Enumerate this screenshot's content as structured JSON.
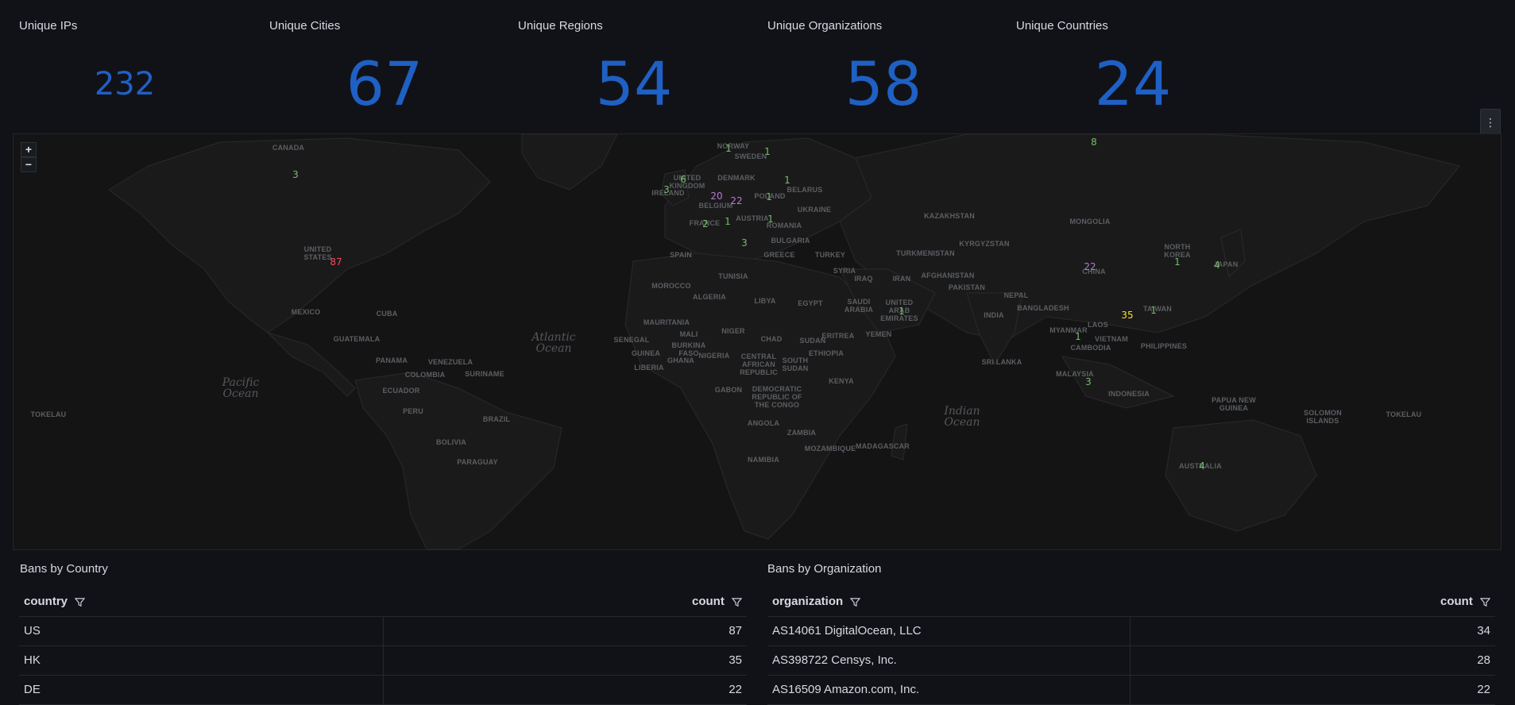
{
  "stats": [
    {
      "title": "Unique IPs",
      "value": "232"
    },
    {
      "title": "Unique Cities",
      "value": "67"
    },
    {
      "title": "Unique Regions",
      "value": "54"
    },
    {
      "title": "Unique Organizations",
      "value": "58"
    },
    {
      "title": "Unique Countries",
      "value": "24"
    }
  ],
  "panel_menu_icon": "vertical-dots-icon",
  "map": {
    "zoom_in": "+",
    "zoom_out": "−",
    "markers": [
      {
        "value": "3"
      },
      {
        "value": "87"
      },
      {
        "value": "1"
      },
      {
        "value": "1"
      },
      {
        "value": "6"
      },
      {
        "value": "3"
      },
      {
        "value": "20"
      },
      {
        "value": "22"
      },
      {
        "value": "1"
      },
      {
        "value": "1"
      },
      {
        "value": "2"
      },
      {
        "value": "1"
      },
      {
        "value": "1"
      },
      {
        "value": "3"
      },
      {
        "value": "8"
      },
      {
        "value": "22"
      },
      {
        "value": "1"
      },
      {
        "value": "4"
      },
      {
        "value": "35"
      },
      {
        "value": "1"
      },
      {
        "value": "1"
      },
      {
        "value": "1"
      },
      {
        "value": "3"
      },
      {
        "value": "4"
      }
    ],
    "labels": {
      "canada": "CANADA",
      "us": "UNITED\nSTATES",
      "mexico": "MEXICO",
      "cuba": "CUBA",
      "guatemala": "GUATEMALA",
      "panama": "PANAMA",
      "venezuela": "VENEZUELA",
      "colombia": "COLOMBIA",
      "suriname": "SURINAME",
      "ecuador": "ECUADOR",
      "peru": "PERU",
      "brazil": "BRAZIL",
      "bolivia": "BOLIVIA",
      "paraguay": "PARAGUAY",
      "norway": "NORWAY",
      "sweden": "SWEDEN",
      "uk": "UNITED\nKINGDOM",
      "ireland": "IRELAND",
      "denmark": "DENMARK",
      "belarus": "BELARUS",
      "poland": "POLAND",
      "belgium": "BELGIUM",
      "ukraine": "UKRAINE",
      "austria": "AUSTRIA",
      "france": "FRANCE",
      "romania": "ROMANIA",
      "bulgaria": "BULGARIA",
      "spain": "SPAIN",
      "greece": "GREECE",
      "turkey": "TURKEY",
      "kazakhstan": "KAZAKHSTAN",
      "mongolia": "MONGOLIA",
      "kyrgyzstan": "KYRGYZSTAN",
      "turkmenistan": "TURKMENISTAN",
      "north_korea": "NORTH\nKOREA",
      "japan": "JAPAN",
      "syria": "SYRIA",
      "iraq": "IRAQ",
      "iran": "IRAN",
      "afghanistan": "AFGHANISTAN",
      "pakistan": "PAKISTAN",
      "china": "CHINA",
      "tunisia": "TUNISIA",
      "morocco": "MOROCCO",
      "algeria": "ALGERIA",
      "libya": "LIBYA",
      "egypt": "EGYPT",
      "saudi": "SAUDI\nARABIA",
      "uae": "UNITED\nARAB\nEMIRATES",
      "nepal": "NEPAL",
      "bangladesh": "BANGLADESH",
      "india": "INDIA",
      "taiwan": "TAIWAN",
      "mauritania": "MAURITANIA",
      "mali": "MALI",
      "niger": "NIGER",
      "chad": "CHAD",
      "sudan": "SUDAN",
      "eritrea": "ERITREA",
      "yemen": "YEMEN",
      "myanmar": "MYANMAR",
      "laos": "LAOS",
      "vietnam": "VIETNAM",
      "cambodia": "CAMBODIA",
      "philippines": "PHILIPPINES",
      "senegal": "SENEGAL",
      "burkina": "BURKINA\nFASO",
      "guinea": "GUINEA",
      "liberia": "LIBERIA",
      "ghana": "GHANA",
      "nigeria": "NIGERIA",
      "car": "CENTRAL\nAFRICAN\nREPUBLIC",
      "south_sudan": "SOUTH\nSUDAN",
      "ethiopia": "ETHIOPIA",
      "sri_lanka": "SRI LANKA",
      "malaysia": "MALAYSIA",
      "gabon": "GABON",
      "drc": "DEMOCRATIC\nREPUBLIC OF\nTHE CONGO",
      "kenya": "KENYA",
      "indonesia": "INDONESIA",
      "png": "PAPUA NEW\nGUINEA",
      "solomon": "SOLOMON\nISLANDS",
      "tokelau_l": "TOKELAU",
      "tokelau_r": "TOKELAU",
      "angola": "ANGOLA",
      "zambia": "ZAMBIA",
      "mozambique": "MOZAMBIQUE",
      "madagascar": "MADAGASCAR",
      "namibia": "NAMIBIA",
      "australia": "AUSTRALIA"
    },
    "oceans": {
      "atlantic": "Atlantic\nOcean",
      "pacific": "Pacific\nOcean",
      "indian": "Indian\nOcean"
    }
  },
  "bans_by_country": {
    "title": "Bans by Country",
    "headers": {
      "left": "country",
      "right": "count"
    },
    "rows": [
      {
        "key": "US",
        "count": "87"
      },
      {
        "key": "HK",
        "count": "35"
      },
      {
        "key": "DE",
        "count": "22"
      }
    ]
  },
  "bans_by_org": {
    "title": "Bans by Organization",
    "headers": {
      "left": "organization",
      "right": "count"
    },
    "rows": [
      {
        "key": "AS14061 DigitalOcean, LLC",
        "count": "34"
      },
      {
        "key": "AS398722 Censys, Inc.",
        "count": "28"
      },
      {
        "key": "AS16509 Amazon.com, Inc.",
        "count": "22"
      }
    ]
  },
  "colors": {
    "stat_value": "#1f60c4",
    "marker_green": "#73bf69",
    "marker_purple": "#b877d9",
    "marker_yellow": "#fade2a",
    "marker_red": "#f2495c"
  }
}
